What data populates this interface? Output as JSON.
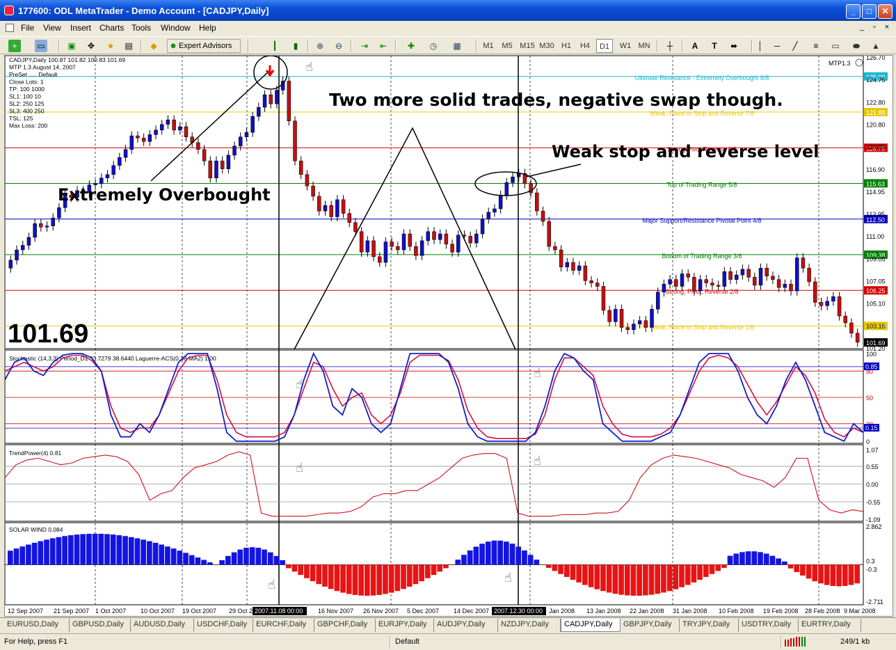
{
  "window": {
    "title": "177600: ODL MetaTrader - Demo Account - [CADJPY,Daily]",
    "minimize": "_",
    "maximize": "□",
    "close": "✕"
  },
  "menu": [
    "File",
    "View",
    "Insert",
    "Charts",
    "Tools",
    "Window",
    "Help"
  ],
  "mdi_controls": [
    "_",
    "▫",
    "×"
  ],
  "toolbar": {
    "expert_advisors": "Expert Advisors",
    "timeframes": [
      "M1",
      "M5",
      "M15",
      "M30",
      "H1",
      "H4",
      "D1",
      "W1",
      "MN"
    ],
    "active_timeframe": "D1",
    "icons": [
      "new-chart-icon",
      "profiles-icon",
      "market-watch-icon",
      "crosshair-icon",
      "favorites-icon",
      "navigator-icon",
      "autotrading-icon",
      "bar-chart-icon",
      "candles-icon",
      "zoom-in-icon",
      "zoom-out-icon",
      "autoscroll-icon",
      "chart-shift-icon",
      "indicators-icon",
      "periods-icon",
      "templates-icon",
      "cursor-icon",
      "vertical-line-icon",
      "horizontal-line-icon",
      "trendline-icon",
      "channel-icon",
      "text-icon",
      "label-icon",
      "arrows-icon",
      "shapes-icon"
    ]
  },
  "chart": {
    "info": {
      "line1": "CADJPY,Daily  100.87 101.82 100.83 101.69",
      "line2": "MTP 1.3  August 14, 2007",
      "line3": "PreSet ..... Default",
      "line4": "Close Lots:  1",
      "line5": "TP:  100  1000",
      "line6": "SL1:  100  10",
      "line7": "SL2:  250  125",
      "line8": "SL3:  400  250",
      "line9": "TSL:  125",
      "line10": "Max Loss:  200"
    },
    "indicator_name": "MTP1.3",
    "big_price": "101.69",
    "annotation_title": "Two more solid trades, negative swap though.",
    "annotation_overbought": "Extremely Overbought",
    "annotation_weak": "Weak stop and reverse level",
    "price_scale": [
      "126.70",
      "124.75",
      "122.80",
      "120.80",
      "118.85",
      "116.90",
      "114.95",
      "112.95",
      "111.00",
      "109.05",
      "107.05",
      "105.10",
      "103.15",
      "101.20"
    ],
    "murrey_levels": [
      {
        "price": 125.0,
        "label": "Ultimate Resistance - Extremely Overbought  8/8",
        "color": "#17b8d4",
        "tag": "125.00"
      },
      {
        "price": 121.88,
        "label": "Weak, Place to Stop and Reverse  7/8",
        "color": "#e8c800",
        "tag": "121.88"
      },
      {
        "price": 118.75,
        "label": "Strong Pivot Reverse  6/8",
        "color": "#d40000",
        "tag": "118.75"
      },
      {
        "price": 115.63,
        "label": "Top of Trading Range  5/8",
        "color": "#008000",
        "tag": "115.63"
      },
      {
        "price": 112.5,
        "label": "Major Support/Resistance Pivotal Point  4/8",
        "color": "#0000c0",
        "tag": "112.50"
      },
      {
        "price": 109.38,
        "label": "Bottom of Trading Range  3/8",
        "color": "#008000",
        "tag": "109.38"
      },
      {
        "price": 106.25,
        "label": "Strong, Pivot, Reverse  2/8",
        "color": "#d40000",
        "tag": "106.25"
      },
      {
        "price": 103.13,
        "label": "Weak, Place to Stop and Reverse  1/8",
        "color": "#e8c800",
        "tag": "103.13"
      }
    ],
    "current_price_tag": "101.69",
    "stoch": {
      "label": "Stochastic (14,3,3) Period_D1 33.7279 38.6440  Laguerre-ACS(0.38-MA2) 1.00",
      "scale": [
        "100",
        "80",
        "50",
        "20",
        "0"
      ],
      "blue_tag": "0.85",
      "blue_tag2": "0.15"
    },
    "trendpower": {
      "label": "TrendPower(4) 0.81",
      "scale": [
        "1.07",
        "0.55",
        "0.00",
        "-0.55",
        "-1.09"
      ]
    },
    "solarwind": {
      "label": "SOLAR WIND 0.084",
      "scale": [
        "2.862",
        "0.3",
        "-0.3",
        "-2.711"
      ]
    },
    "date_axis": [
      "12 Sep 2007",
      "21 Sep 2007",
      "1 Oct 2007",
      "10 Oct 2007",
      "19 Oct 2007",
      "29 Oct 2",
      "16 Nov 2007",
      "26 Nov 2007",
      "5 Dec 2007",
      "14 Dec 2007",
      "Jan 2008",
      "13 Jan 2008",
      "22 Jan 2008",
      "31 Jan 2008",
      "10 Feb 2008",
      "19 Feb 2008",
      "28 Feb 2008",
      "9 Mar 2008"
    ],
    "cursor_dates": [
      "2007.11.08 00:00",
      "2007.12.30 00:00"
    ]
  },
  "tabs": [
    "EURUSD,Daily",
    "GBPUSD,Daily",
    "AUDUSD,Daily",
    "USDCHF,Daily",
    "EURCHF,Daily",
    "GBPCHF,Daily",
    "EURJPY,Daily",
    "AUDJPY,Daily",
    "NZDJPY,Daily",
    "CADJPY,Daily",
    "GBPJPY,Daily",
    "TRYJPY,Daily",
    "USDTRY,Daily",
    "EURTRY,Daily"
  ],
  "active_tab": "CADJPY,Daily",
  "status": {
    "help": "For Help, press F1",
    "profile": "Default",
    "traffic": "249/1 kb"
  }
}
